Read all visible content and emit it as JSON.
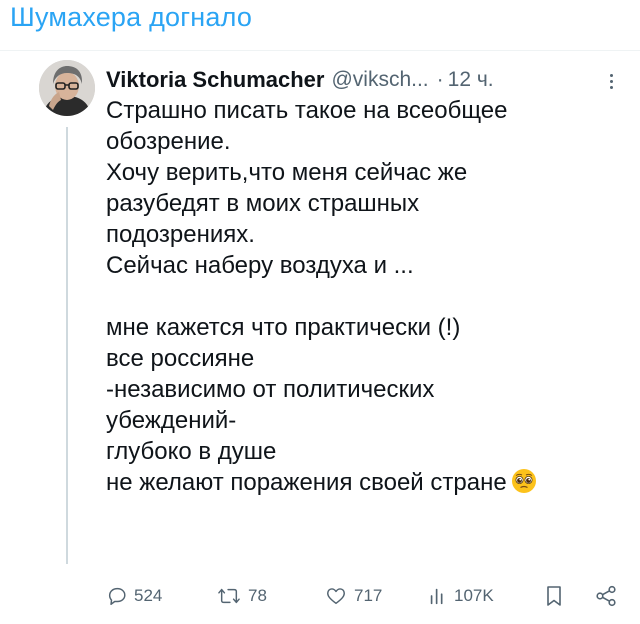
{
  "caption": "Шумахера догнало",
  "tweet": {
    "author_name": "Viktoria Schumacher",
    "handle": "@viksch...",
    "separator": "·",
    "time": "12 ч.",
    "lines": [
      "Страшно писать такое на всеобщее",
      "обозрение.",
      "Хочу верить,что меня сейчас же",
      "разубедят в моих страшных",
      "подозрениях.",
      "Сейчас наберу воздуха и ...",
      "",
      "мне кажется что практически (!)",
      "все россияне",
      "-независимо от политических",
      "убеждений-",
      "глубоко в душе",
      "не желают поражения своей стране"
    ],
    "trailing_emoji": "pleading-face-emoji"
  },
  "actions": {
    "replies": "524",
    "reposts": "78",
    "likes": "717",
    "views": "107K"
  },
  "icons": {
    "reply": "reply-icon",
    "repost": "repost-icon",
    "like": "heart-icon",
    "views": "views-icon",
    "bookmark": "bookmark-icon",
    "share": "share-icon",
    "more": "more-icon"
  },
  "colors": {
    "caption": "#2aa4f4",
    "text": "#0f1419",
    "secondary": "#536471",
    "thread_line": "#cfd9de"
  }
}
